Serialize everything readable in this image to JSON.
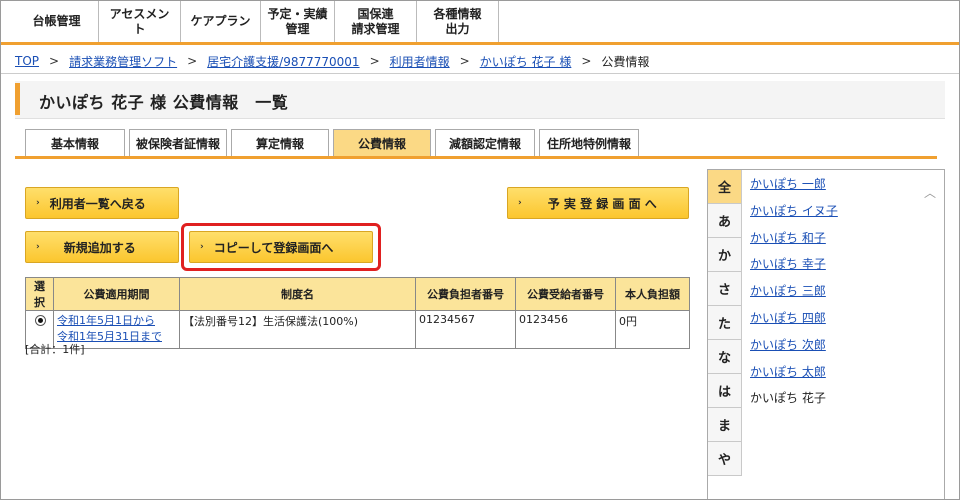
{
  "nav": {
    "items": [
      {
        "label": "台帳管理"
      },
      {
        "label": "アセスメント"
      },
      {
        "label": "ケアプラン"
      },
      {
        "label": "予定・実績\n管理"
      },
      {
        "label": "国保連\n請求管理"
      },
      {
        "label": "各種情報\n出力"
      }
    ]
  },
  "breadcrumb": {
    "top": "TOP",
    "b1": "請求業務管理ソフト",
    "b2": "居宅介護支援/9877770001",
    "b3": "利用者情報",
    "b4": "かいぽち 花子 様",
    "current": "公費情報",
    "sep": ">"
  },
  "page": {
    "title": "かいぽち 花子 様 公費情報　一覧"
  },
  "tabs": [
    {
      "label": "基本情報",
      "active": false
    },
    {
      "label": "被保険者証情報",
      "active": false
    },
    {
      "label": "算定情報",
      "active": false
    },
    {
      "label": "公費情報",
      "active": true
    },
    {
      "label": "減額認定情報",
      "active": false
    },
    {
      "label": "住所地特例情報",
      "active": false
    }
  ],
  "buttons": {
    "back": "利用者一覧へ戻る",
    "schedule": "予 実 登 録 画 面 へ",
    "new": "新規追加する",
    "copy": "コピーして登録画面へ"
  },
  "table": {
    "headers": [
      "選択",
      "公費適用期間",
      "制度名",
      "公費負担者番号",
      "公費受給者番号",
      "本人負担額"
    ],
    "rows": [
      {
        "selected": true,
        "period_from": "令和1年5月1日から",
        "period_to": "令和1年5月31日まで",
        "system": "【法別番号12】生活保護法(100%)",
        "payer": "01234567",
        "recipient": "0123456",
        "amount": "0円"
      }
    ],
    "total": "[合計：1件]"
  },
  "side": {
    "kana": [
      "全",
      "あ",
      "か",
      "さ",
      "た",
      "な",
      "は",
      "ま",
      "や"
    ],
    "active_kana": "全",
    "names": [
      {
        "label": "かいぽち 一郎",
        "link": true
      },
      {
        "label": "かいぽち イヌ子",
        "link": true
      },
      {
        "label": "かいぽち 和子",
        "link": true
      },
      {
        "label": "かいぽち 幸子",
        "link": true
      },
      {
        "label": "かいぽち 三郎",
        "link": true
      },
      {
        "label": "かいぽち 四郎",
        "link": true
      },
      {
        "label": "かいぽち 次郎",
        "link": true
      },
      {
        "label": "かいぽち 太郎",
        "link": true
      },
      {
        "label": "かいぽち 花子",
        "link": false
      }
    ]
  },
  "colors": {
    "accent": "#f0a030",
    "button": "#fbc62e",
    "highlight": "#e02020",
    "link": "#1a4fb5"
  }
}
